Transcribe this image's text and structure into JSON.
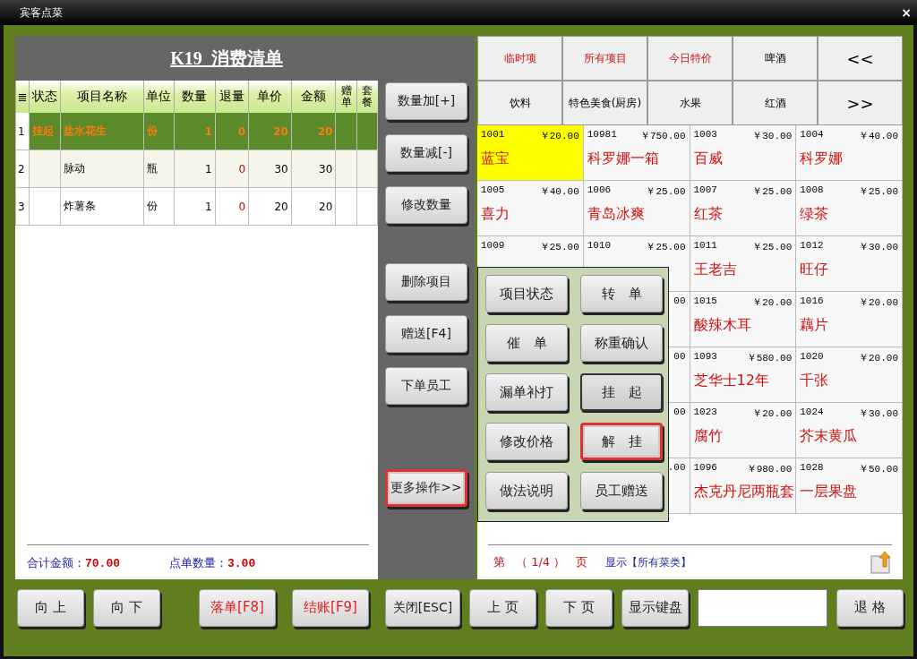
{
  "window": {
    "title": "宾客点菜",
    "close": "×"
  },
  "order": {
    "title": "K19  消费清单",
    "columns": [
      {
        "label": "≣",
        "kind": "index"
      },
      {
        "label": "状态",
        "kind": "text"
      },
      {
        "label": "项目名称",
        "kind": "text"
      },
      {
        "label": "单位",
        "kind": "text"
      },
      {
        "label": "数量",
        "kind": "num"
      },
      {
        "label": "退量",
        "kind": "ret"
      },
      {
        "label": "单价",
        "kind": "num"
      },
      {
        "label": "金额",
        "kind": "num"
      },
      {
        "label": "赠单",
        "kind": "narrow"
      },
      {
        "label": "套餐",
        "kind": "narrow"
      }
    ],
    "rows": [
      {
        "selected": true,
        "cells": [
          "1",
          "挂起",
          "盐水花生",
          "份",
          "1",
          "0",
          "20",
          "20",
          "",
          ""
        ]
      },
      {
        "selected": false,
        "cells": [
          "2",
          "",
          "脉动",
          "瓶",
          "1",
          "0",
          "30",
          "30",
          "",
          ""
        ]
      },
      {
        "selected": false,
        "cells": [
          "3",
          "",
          "炸薯条",
          "份",
          "1",
          "0",
          "20",
          "20",
          "",
          ""
        ]
      }
    ],
    "totals": [
      {
        "label": "合计金额：",
        "value": "70.00"
      },
      {
        "label": "点单数量：",
        "value": "3.00"
      }
    ]
  },
  "side_buttons": [
    {
      "label": "数量加[+]",
      "highlighted": false
    },
    {
      "label": "数量减[-]",
      "highlighted": false
    },
    {
      "label": "修改数量",
      "highlighted": false
    },
    {
      "label": "删除项目",
      "highlighted": false
    },
    {
      "label": "赠送[F4]",
      "highlighted": false
    },
    {
      "label": "下单员工",
      "highlighted": false
    },
    {
      "label": "更多操作>>",
      "highlighted": true
    }
  ],
  "categories": [
    {
      "label": "临时项",
      "kind": "special"
    },
    {
      "label": "所有项目",
      "kind": "special"
    },
    {
      "label": "今日特价",
      "kind": "special"
    },
    {
      "label": "啤酒",
      "kind": "normal"
    },
    {
      "label": "<<",
      "kind": "nav"
    },
    {
      "label": "饮料",
      "kind": "normal"
    },
    {
      "label": "特色美食(厨房)",
      "kind": "normal"
    },
    {
      "label": "水果",
      "kind": "normal"
    },
    {
      "label": "红酒",
      "kind": "normal"
    },
    {
      "label": ">>",
      "kind": "nav"
    }
  ],
  "dishes": [
    {
      "code": "1001",
      "price": "￥20.00",
      "name": "蓝宝",
      "selected": true
    },
    {
      "code": "10981",
      "price": "￥750.00",
      "name": "科罗娜一箱",
      "selected": false
    },
    {
      "code": "1003",
      "price": "￥30.00",
      "name": "百威",
      "selected": false
    },
    {
      "code": "1004",
      "price": "￥40.00",
      "name": "科罗娜",
      "selected": false
    },
    {
      "code": "1005",
      "price": "￥40.00",
      "name": "喜力",
      "selected": false
    },
    {
      "code": "1006",
      "price": "￥25.00",
      "name": "青岛冰爽",
      "selected": false
    },
    {
      "code": "1007",
      "price": "￥25.00",
      "name": "红茶",
      "selected": false
    },
    {
      "code": "1008",
      "price": "￥25.00",
      "name": "绿茶",
      "selected": false
    },
    {
      "code": "1009",
      "price": "￥25.00",
      "selected": false
    },
    {
      "code": "1010",
      "price": "￥25.00",
      "selected": false
    },
    {
      "code": "1011",
      "price": "￥25.00",
      "name": "王老吉",
      "selected": false
    },
    {
      "code": "1012",
      "price": "￥30.00",
      "name": "旺仔",
      "selected": false
    },
    {
      "price": "00",
      "selected": false
    },
    {
      "code": "1015",
      "price": "￥20.00",
      "name": "酸辣木耳",
      "selected": false
    },
    {
      "code": "1016",
      "price": "￥20.00",
      "name": "藕片",
      "selected": false
    },
    {
      "price": "00",
      "selected": false
    },
    {
      "code": "1093",
      "price": "￥580.00",
      "name": "芝华士12年",
      "selected": false
    },
    {
      "code": "1020",
      "price": "￥20.00",
      "name": "千张",
      "selected": false
    },
    {
      "price": "00",
      "selected": false
    },
    {
      "code": "1023",
      "price": "￥20.00",
      "name": "腐竹",
      "selected": false
    },
    {
      "code": "1024",
      "price": "￥30.00",
      "name": "芥末黄瓜",
      "selected": false
    },
    {
      "price": ".00",
      "selected": false
    },
    {
      "code": "1096",
      "price": "￥980.00",
      "name": "杰克丹尼两瓶套",
      "selected": false
    },
    {
      "code": "1028",
      "price": "￥50.00",
      "name": "一层果盘",
      "selected": false
    }
  ],
  "menu": [
    {
      "label": "项目状态",
      "pressed": false,
      "highlighted": false
    },
    {
      "label": "转　单",
      "pressed": false,
      "highlighted": false
    },
    {
      "label": "催　单",
      "pressed": false,
      "highlighted": false
    },
    {
      "label": "称重确认",
      "pressed": false,
      "highlighted": false
    },
    {
      "label": "漏单补打",
      "pressed": false,
      "highlighted": false
    },
    {
      "label": "挂　起",
      "pressed": true,
      "highlighted": false
    },
    {
      "label": "修改价格",
      "pressed": false,
      "highlighted": false
    },
    {
      "label": "解　挂",
      "pressed": false,
      "highlighted": true
    },
    {
      "label": "做法说明",
      "pressed": false,
      "highlighted": false
    },
    {
      "label": "员工赠送",
      "pressed": false,
      "highlighted": false
    }
  ],
  "pager": {
    "prefix": "第",
    "page": "（ 1/4 ）",
    "suffix": "页",
    "filter": "显示【所有菜类】"
  },
  "bottom_buttons": [
    {
      "label": "向 上",
      "kind": "normal"
    },
    {
      "label": "向 下",
      "kind": "normal"
    },
    {
      "label": "落单[F8]",
      "kind": "alert"
    },
    {
      "label": "结账[F9]",
      "kind": "alert"
    },
    {
      "label": "关闭[ESC]",
      "kind": "normal"
    },
    {
      "label": "上 页",
      "kind": "normal"
    },
    {
      "label": "下 页",
      "kind": "normal"
    },
    {
      "label": "显示键盘",
      "kind": "normal"
    },
    {
      "kind": "input"
    },
    {
      "label": "退 格",
      "kind": "normal"
    }
  ]
}
